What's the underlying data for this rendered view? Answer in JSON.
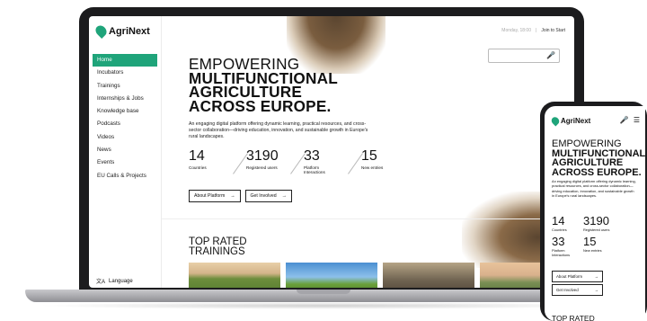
{
  "app": {
    "name": "AgriNext"
  },
  "sidebar": {
    "items": [
      {
        "label": "Home",
        "active": true
      },
      {
        "label": "Incubators"
      },
      {
        "label": "Trainings"
      },
      {
        "label": "Internships & Jobs"
      },
      {
        "label": "Knowledge base"
      },
      {
        "label": "Podcasts"
      },
      {
        "label": "Videos"
      },
      {
        "label": "News"
      },
      {
        "label": "Events"
      },
      {
        "label": "EU Calls & Projects"
      }
    ],
    "language_label": "Language"
  },
  "topbar": {
    "muted": "Monday, 18:00",
    "join_label": "Join to Start"
  },
  "hero": {
    "title_line1": "EMPOWERING",
    "title_line2": "MULTIFUNCTIONAL",
    "title_line3": "AGRICULTURE",
    "title_line4": "ACROSS EUROPE.",
    "description": "An engaging digital platform offering dynamic learning, practical resources, and cross-sector collaboration—driving education, innovation, and sustainable growth in Europe's rural landscapes."
  },
  "stats": [
    {
      "value": "14",
      "label": "Countries"
    },
    {
      "value": "3190",
      "label": "Registered users"
    },
    {
      "value": "33",
      "label": "Platform Interactions"
    },
    {
      "value": "15",
      "label": "New entries"
    }
  ],
  "buttons": {
    "about": "About Platform",
    "get_involved": "Get Involved",
    "arrow": "→"
  },
  "sections": {
    "top_rated_line1": "TOP RATED",
    "top_rated_line2": "TRAININGS",
    "top_rated_short": "TOP RATED"
  },
  "colors": {
    "accent": "#1fa47a"
  }
}
